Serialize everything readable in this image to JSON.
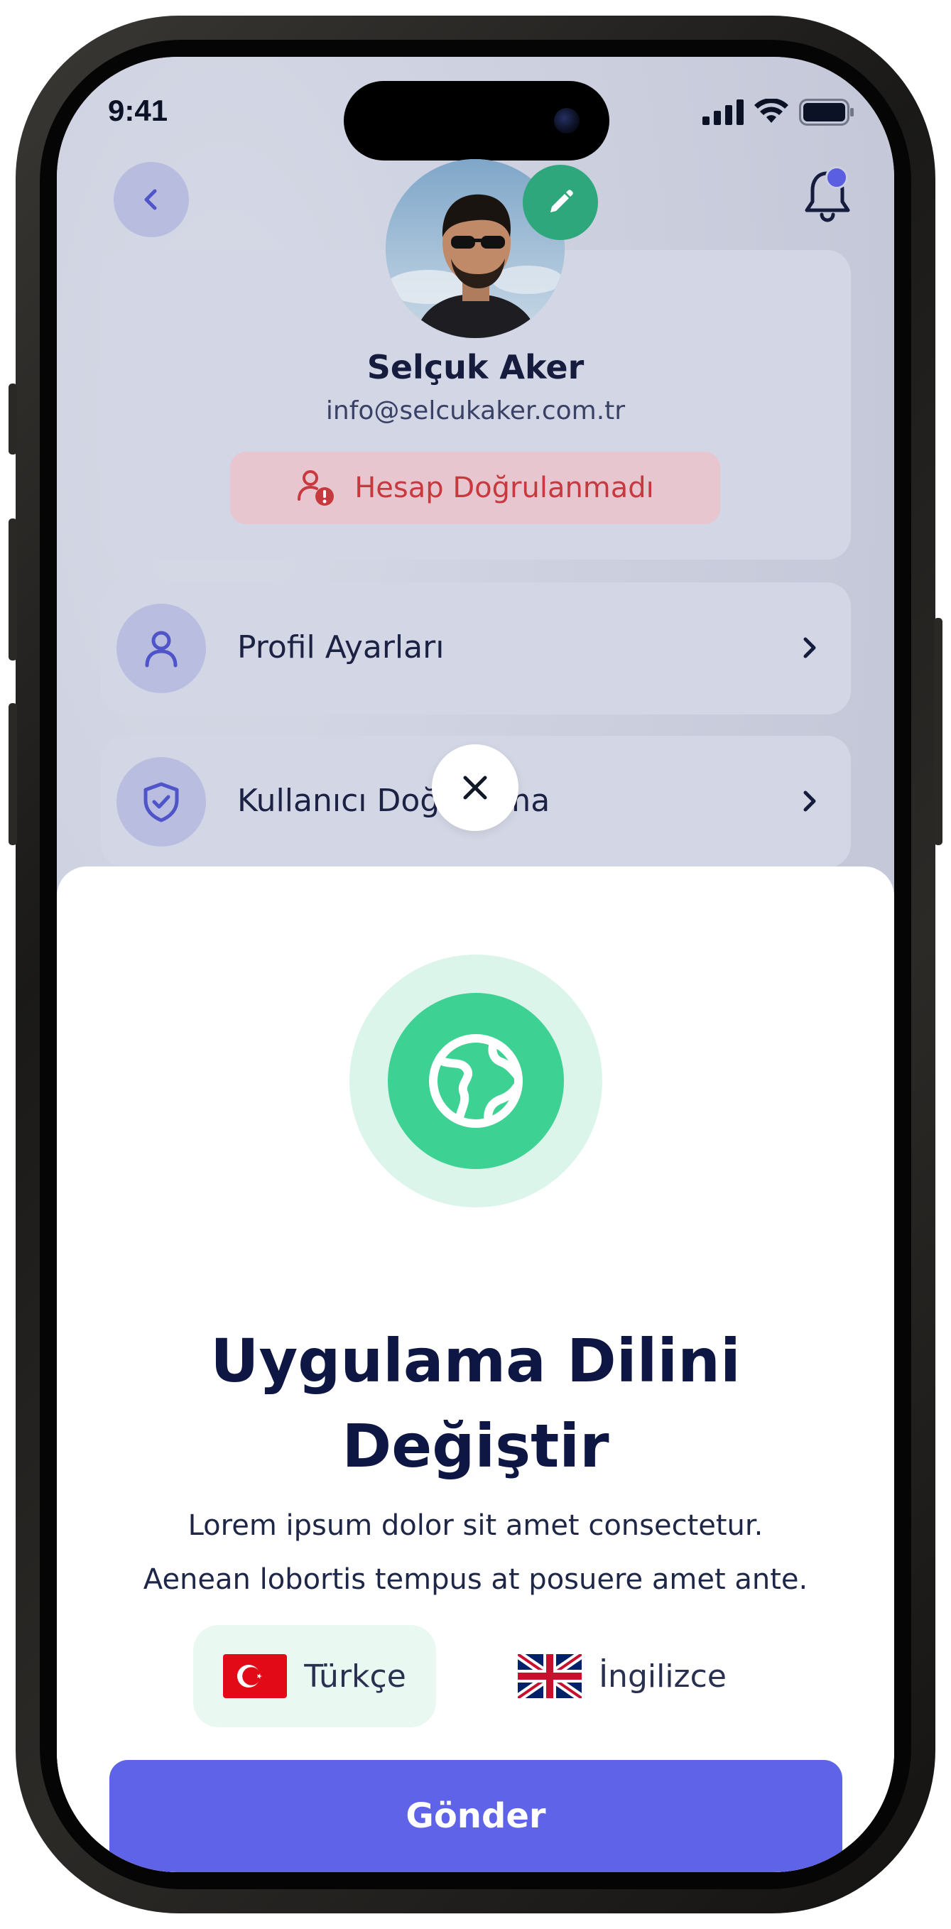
{
  "status_bar": {
    "time": "9:41"
  },
  "profile": {
    "name": "Selçuk Aker",
    "email": "info@selcukaker.com.tr",
    "verification_status": "Hesap Doğrulanmadı"
  },
  "menu": {
    "items": [
      {
        "label": "Profil Ayarları",
        "icon": "user-icon"
      },
      {
        "label": "Kullanıcı Doğrulama",
        "icon": "shield-check-icon"
      }
    ]
  },
  "language_sheet": {
    "icon": "globe-icon",
    "title": "Uygulama Dilini Değiştir",
    "description_line1": "Lorem ipsum dolor sit amet consectetur.",
    "description_line2": "Aenean lobortis tempus at posuere amet ante.",
    "options": [
      {
        "label": "Türkçe",
        "flag": "turkey-flag",
        "selected": true
      },
      {
        "label": "İngilizce",
        "flag": "uk-flag",
        "selected": false
      }
    ],
    "submit_label": "Gönder"
  },
  "colors": {
    "accent": "#5f63e8",
    "success": "#3dd293",
    "warning_text": "#c8393f",
    "title": "#0e1744"
  }
}
